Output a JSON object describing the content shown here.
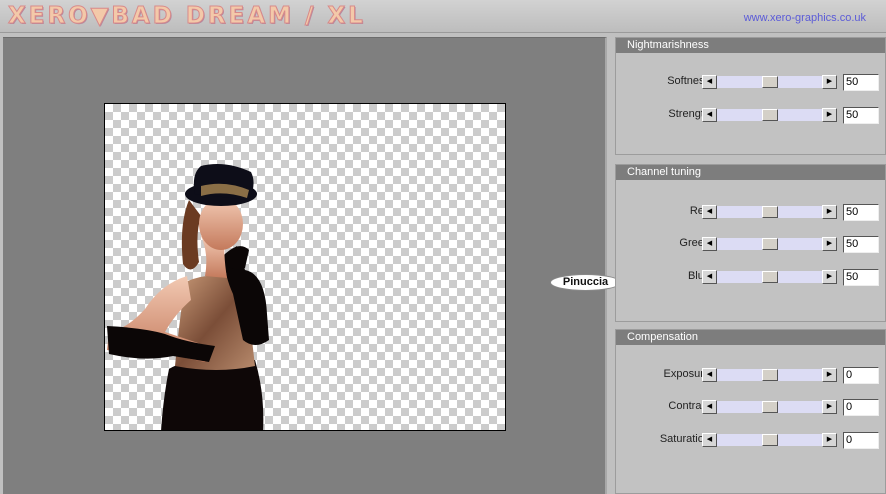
{
  "app": {
    "logo": "XERO▼BAD DREAM / XL",
    "url": "www.xero-graphics.co.uk",
    "watermark": "Pinuccia"
  },
  "panels": [
    {
      "title": "Nightmarishness",
      "controls": [
        {
          "label": "Softness",
          "value": "50",
          "level": 0.5
        },
        {
          "label": "Strength",
          "value": "50",
          "level": 0.5
        }
      ]
    },
    {
      "title": "Channel tuning",
      "controls": [
        {
          "label": "Red",
          "value": "50",
          "level": 0.5
        },
        {
          "label": "Green",
          "value": "50",
          "level": 0.5
        },
        {
          "label": "Blue",
          "value": "50",
          "level": 0.5
        }
      ]
    },
    {
      "title": "Compensation",
      "controls": [
        {
          "label": "Exposure",
          "value": "0",
          "level": 0.5
        },
        {
          "label": "Contrast",
          "value": "0",
          "level": 0.5
        },
        {
          "label": "Saturation",
          "value": "0",
          "level": 0.5
        }
      ]
    }
  ],
  "colors": {
    "header": "#7d7d7d",
    "track": "#dcdcf4",
    "preview_bg": "#7f7f7f"
  }
}
